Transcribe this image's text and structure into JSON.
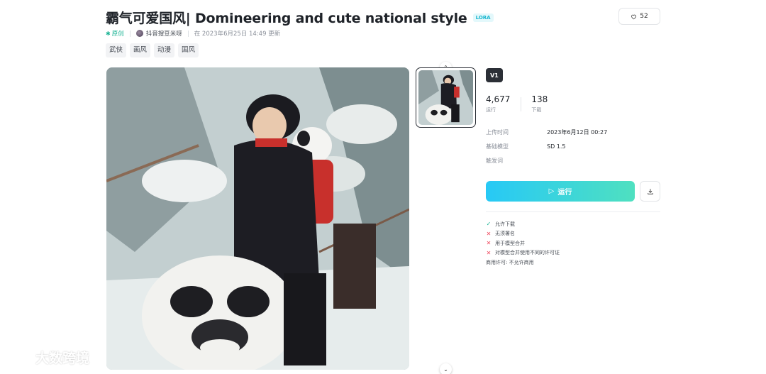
{
  "title": "霸气可爱国风| Domineering and cute national style",
  "type_badge": "LORA",
  "likes": "52",
  "meta": {
    "original": "原创",
    "author": "抖音搜豆米呀",
    "updated": "在 2023年6月25日 14:49 更新"
  },
  "tags": [
    "武侠",
    "画风",
    "动漫",
    "国风"
  ],
  "version": "V1",
  "stats": [
    {
      "num": "4,677",
      "label": "运行"
    },
    {
      "num": "138",
      "label": "下载"
    }
  ],
  "info": [
    {
      "key": "上传时间",
      "value": "2023年6月12日 00:27"
    },
    {
      "key": "基础模型",
      "value": "SD 1.5"
    },
    {
      "key": "触发词",
      "value": ""
    }
  ],
  "run_label": "运行",
  "permissions": [
    {
      "icon": "check",
      "label": "允许下载"
    },
    {
      "icon": "cross",
      "label": "无须署名"
    },
    {
      "icon": "cross",
      "label": "用于模型合并"
    },
    {
      "icon": "cross",
      "label": "对模型合并使用不同的许可证"
    }
  ],
  "commercial": "商用许可: 不允许商用",
  "watermark": "大数跨境",
  "colors": {
    "accent_start": "#27c9f6",
    "accent_end": "#4fe0c0",
    "ok": "#1ab394",
    "no": "#f0465c",
    "lora": "#17b6cf"
  }
}
